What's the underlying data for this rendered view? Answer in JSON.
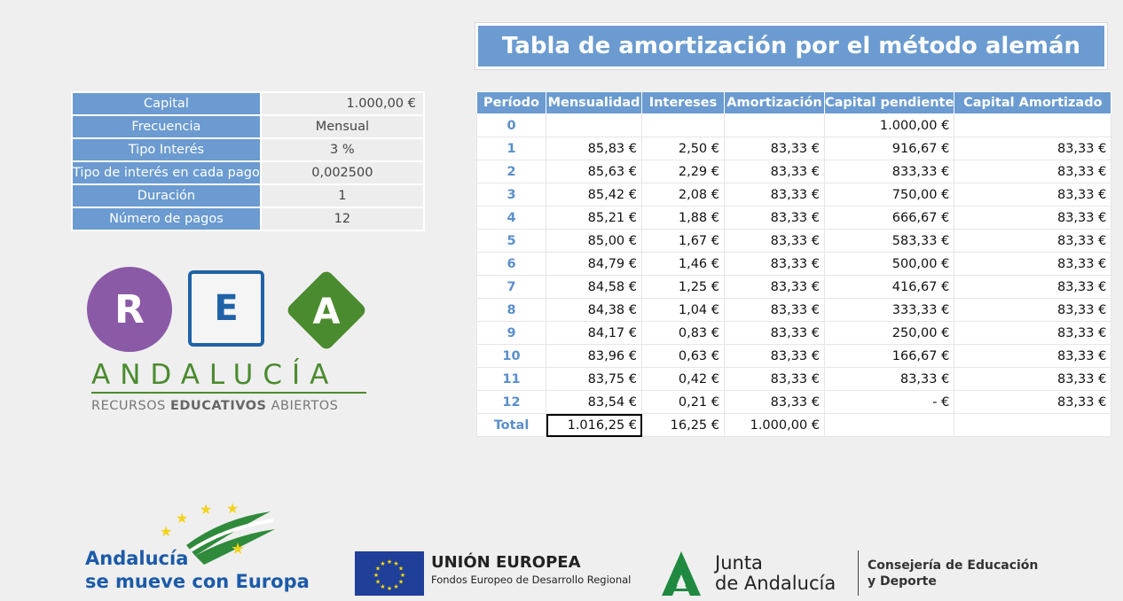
{
  "title": "Tabla de amortización por el método alemán",
  "params": [
    {
      "label": "Capital",
      "value": "1.000,00 €",
      "align": "right"
    },
    {
      "label": "Frecuencia",
      "value": "Mensual",
      "align": "center"
    },
    {
      "label": "Tipo Interés",
      "value": "3 %",
      "align": "center"
    },
    {
      "label": "Tipo de interés en cada pago",
      "value": "0,002500",
      "align": "center"
    },
    {
      "label": "Duración",
      "value": "1",
      "align": "center"
    },
    {
      "label": "Número  de pagos",
      "value": "12",
      "align": "center"
    }
  ],
  "table": {
    "headers": [
      "Período",
      "Mensualidad",
      "Intereses",
      "Amortización",
      "Capital pendiente",
      "Capital Amortizado"
    ],
    "rows": [
      [
        "0",
        "",
        "",
        "",
        "1.000,00 €",
        ""
      ],
      [
        "1",
        "85,83 €",
        "2,50 €",
        "83,33 €",
        "916,67 €",
        "83,33 €"
      ],
      [
        "2",
        "85,63 €",
        "2,29 €",
        "83,33 €",
        "833,33 €",
        "83,33 €"
      ],
      [
        "3",
        "85,42 €",
        "2,08 €",
        "83,33 €",
        "750,00 €",
        "83,33 €"
      ],
      [
        "4",
        "85,21 €",
        "1,88 €",
        "83,33 €",
        "666,67 €",
        "83,33 €"
      ],
      [
        "5",
        "85,00 €",
        "1,67 €",
        "83,33 €",
        "583,33 €",
        "83,33 €"
      ],
      [
        "6",
        "84,79 €",
        "1,46 €",
        "83,33 €",
        "500,00 €",
        "83,33 €"
      ],
      [
        "7",
        "84,58 €",
        "1,25 €",
        "83,33 €",
        "416,67 €",
        "83,33 €"
      ],
      [
        "8",
        "84,38 €",
        "1,04 €",
        "83,33 €",
        "333,33 €",
        "83,33 €"
      ],
      [
        "9",
        "84,17 €",
        "0,83 €",
        "83,33 €",
        "250,00 €",
        "83,33 €"
      ],
      [
        "10",
        "83,96 €",
        "0,63 €",
        "83,33 €",
        "166,67 €",
        "83,33 €"
      ],
      [
        "11",
        "83,75 €",
        "0,42 €",
        "83,33 €",
        "83,33 €",
        "83,33 €"
      ],
      [
        "12",
        "83,54 €",
        "0,21 €",
        "83,33 €",
        "- €",
        "83,33 €"
      ]
    ],
    "total": [
      "Total",
      "1.016,25 €",
      "16,25 €",
      "1.000,00 €",
      "",
      ""
    ]
  },
  "rea": {
    "r": "R",
    "e": "E",
    "a": "A",
    "andalucia": "ANDALUCÍA",
    "sub_pre": "RECURSOS ",
    "sub_bold": "EDUCATIVOS",
    "sub_post": " ABIERTOS"
  },
  "footer": {
    "andalucia_line1": "Andalucía",
    "andalucia_line2": "se mueve con Europa",
    "eu_title": "UNIÓN EUROPEA",
    "eu_sub": "Fondos Europeo de Desarrollo Regional",
    "junta_line1": "Junta",
    "junta_line2": "de Andalucía",
    "conse_line1": "Consejería de Educación",
    "conse_line2": "y Deporte"
  },
  "colors": {
    "header_blue": "#6b9bd0",
    "period_blue": "#5a8fcb",
    "rea_purple": "#8b5aa6",
    "rea_blue": "#1f62a7",
    "rea_green": "#4b8b2f"
  }
}
